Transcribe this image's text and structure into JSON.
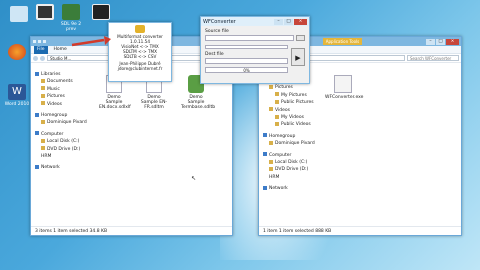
{
  "desktop": {
    "icons": [
      {
        "label": ""
      },
      {
        "label": ""
      },
      {
        "label": "SDL 9e\n2 prev"
      },
      {
        "label": ""
      },
      {
        "label": ""
      },
      {
        "label": "Word 2010"
      }
    ]
  },
  "about_box": {
    "title": "Multiformat converter 1.0.11.54",
    "lines": [
      "VisioNet <-> TMX",
      "SDLTM <-> TMX",
      "SDLTB <-> CSV"
    ],
    "author": "Jean-Philippe Dubré",
    "email": "jdore@clubinternet.fr"
  },
  "left_explorer": {
    "ribbon": {
      "file": "File",
      "tabs": [
        "Home",
        "Share",
        "View"
      ]
    },
    "path": "Studio M...",
    "nav": [
      {
        "label": "Libraries",
        "level": 0
      },
      {
        "label": "Documents",
        "level": 1
      },
      {
        "label": "Music",
        "level": 1
      },
      {
        "label": "Pictures",
        "level": 1
      },
      {
        "label": "Videos",
        "level": 1
      },
      {
        "label": "Homegroup",
        "level": 0
      },
      {
        "label": "Dominique Pivard",
        "level": 1
      },
      {
        "label": "Computer",
        "level": 0
      },
      {
        "label": "Local Disk (C:)",
        "level": 1
      },
      {
        "label": "DVD Drive (D:) HRM",
        "level": 1
      },
      {
        "label": "Network",
        "level": 0
      }
    ],
    "files": [
      {
        "label": "Demo Sample EN.docx.sdlxlf"
      },
      {
        "label": "Demo Sample EN-FR.sdltm"
      },
      {
        "label": "Demo Sample Termbase.sdltb"
      }
    ],
    "status": "3 items    1 item selected 34.8 KB"
  },
  "wfconverter": {
    "title": "WFConverter",
    "source_label": "Source file",
    "dest_label": "Dest file",
    "progress_text": "0%",
    "progress": 0
  },
  "right_explorer": {
    "app_tools": "Application Tools",
    "path": "WFConverter",
    "search_placeholder": "Search WFConverter",
    "nav": [
      {
        "label": "Music",
        "level": 1
      },
      {
        "label": "Pictures",
        "level": 1
      },
      {
        "label": "My Pictures",
        "level": 2
      },
      {
        "label": "Public Pictures",
        "level": 2
      },
      {
        "label": "Videos",
        "level": 1
      },
      {
        "label": "My Videos",
        "level": 2
      },
      {
        "label": "Public Videos",
        "level": 2
      },
      {
        "label": "Homegroup",
        "level": 0
      },
      {
        "label": "Dominique Pivard",
        "level": 1
      },
      {
        "label": "Computer",
        "level": 0
      },
      {
        "label": "Local Disk (C:)",
        "level": 1
      },
      {
        "label": "DVD Drive (D:) HRM",
        "level": 1
      },
      {
        "label": "Network",
        "level": 0
      }
    ],
    "file": {
      "label": "WFConverter.exe"
    },
    "status": "1 item    1 item selected 888 KB"
  },
  "colors": {
    "accent": "#1a6ab0",
    "arrow": "#d23a2a",
    "app_tools": "#e5b63a"
  }
}
